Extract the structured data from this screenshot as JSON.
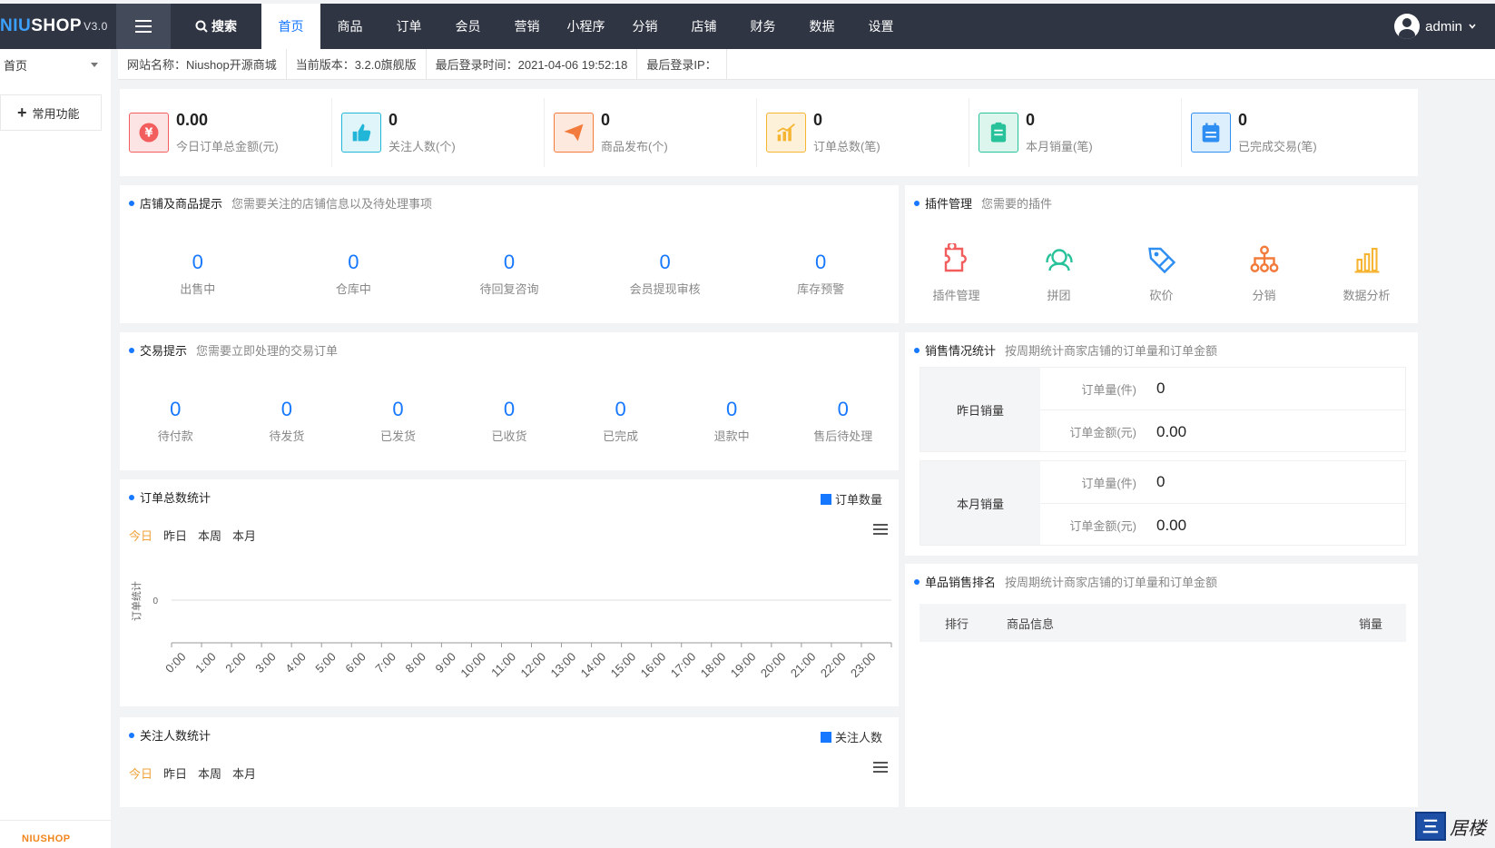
{
  "brand": {
    "name_a": "NIU",
    "name_b": "SHOP",
    "version": "V3.0",
    "footer_logo": "NIUSHOP"
  },
  "topnav": {
    "search": "搜索",
    "items": [
      "首页",
      "商品",
      "订单",
      "会员",
      "营销",
      "小程序",
      "分销",
      "店铺",
      "财务",
      "数据",
      "设置"
    ],
    "active": "首页",
    "user": "admin"
  },
  "sidebar": {
    "home": "首页",
    "common": "常用功能"
  },
  "infobar": [
    "网站名称：Niushop开源商城",
    "当前版本：3.2.0旗舰版",
    "最后登录时间：2021-04-06 19:52:18",
    "最后登录IP："
  ],
  "stats": [
    {
      "value": "0.00",
      "label": "今日订单总金额(元)",
      "icon": "yen-icon",
      "color": "#f25d5d",
      "bg": "#fde4e4"
    },
    {
      "value": "0",
      "label": "关注人数(个)",
      "icon": "thumbs-up-icon",
      "color": "#21b6d8",
      "bg": "#dff5fa"
    },
    {
      "value": "0",
      "label": "商品发布(个)",
      "icon": "paper-plane-icon",
      "color": "#f27a3b",
      "bg": "#fde9de"
    },
    {
      "value": "0",
      "label": "订单总数(笔)",
      "icon": "bar-chart-icon",
      "color": "#f5b431",
      "bg": "#fdf2d9"
    },
    {
      "value": "0",
      "label": "本月销量(笔)",
      "icon": "clipboard-icon",
      "color": "#27c29a",
      "bg": "#dcf6ee"
    },
    {
      "value": "0",
      "label": "已完成交易(笔)",
      "icon": "calendar-icon",
      "color": "#2f8ef2",
      "bg": "#ddeefd"
    }
  ],
  "store_tips": {
    "title": "店铺及商品提示",
    "subtitle": "您需要关注的店铺信息以及待处理事项",
    "items": [
      {
        "value": "0",
        "label": "出售中"
      },
      {
        "value": "0",
        "label": "仓库中"
      },
      {
        "value": "0",
        "label": "待回复咨询"
      },
      {
        "value": "0",
        "label": "会员提现审核"
      },
      {
        "value": "0",
        "label": "库存预警"
      }
    ]
  },
  "plugins": {
    "title": "插件管理",
    "subtitle": "您需要的插件",
    "items": [
      {
        "label": "插件管理",
        "icon": "puzzle-icon",
        "color": "#f25d5d"
      },
      {
        "label": "拼团",
        "icon": "group-icon",
        "color": "#27c29a"
      },
      {
        "label": "砍价",
        "icon": "tag-icon",
        "color": "#2f8ef2"
      },
      {
        "label": "分销",
        "icon": "network-icon",
        "color": "#f27a3b"
      },
      {
        "label": "数据分析",
        "icon": "column-chart-icon",
        "color": "#f5b431"
      }
    ]
  },
  "trade_tips": {
    "title": "交易提示",
    "subtitle": "您需要立即处理的交易订单",
    "items": [
      {
        "value": "0",
        "label": "待付款"
      },
      {
        "value": "0",
        "label": "待发货"
      },
      {
        "value": "0",
        "label": "已发货"
      },
      {
        "value": "0",
        "label": "已收货"
      },
      {
        "value": "0",
        "label": "已完成"
      },
      {
        "value": "0",
        "label": "退款中"
      },
      {
        "value": "0",
        "label": "售后待处理"
      }
    ]
  },
  "sales_stats": {
    "title": "销售情况统计",
    "subtitle": "按周期统计商家店铺的订单量和订单金额",
    "blocks": [
      {
        "name": "昨日销量",
        "rows": [
          {
            "k": "订单量(件)",
            "v": "0"
          },
          {
            "k": "订单金额(元)",
            "v": "0.00"
          }
        ]
      },
      {
        "name": "本月销量",
        "rows": [
          {
            "k": "订单量(件)",
            "v": "0"
          },
          {
            "k": "订单金额(元)",
            "v": "0.00"
          }
        ]
      }
    ]
  },
  "order_chart": {
    "title": "订单总数统计",
    "periods": [
      "今日",
      "昨日",
      "本周",
      "本月"
    ],
    "active_period": "今日"
  },
  "ranking": {
    "title": "单品销售排名",
    "subtitle": "按周期统计商家店铺的订单量和订单金额",
    "columns": [
      "排行",
      "商品信息",
      "销量"
    ]
  },
  "follow_chart": {
    "title": "关注人数统计",
    "legend": "关注人数",
    "periods": [
      "今日",
      "昨日",
      "本周",
      "本月"
    ],
    "active_period": "今日"
  },
  "chart_data": {
    "type": "line",
    "ylabel": "订单统计",
    "x": [
      "0:00",
      "1:00",
      "2:00",
      "3:00",
      "4:00",
      "5:00",
      "6:00",
      "7:00",
      "8:00",
      "9:00",
      "10:00",
      "11:00",
      "12:00",
      "13:00",
      "14:00",
      "15:00",
      "16:00",
      "17:00",
      "18:00",
      "19:00",
      "20:00",
      "21:00",
      "22:00",
      "23:00"
    ],
    "series": [
      {
        "name": "订单数量",
        "values": []
      }
    ],
    "yticks": [
      "0"
    ],
    "legend": "top-right",
    "color": "#1677ff"
  },
  "watermark": {
    "text": "居楼"
  }
}
